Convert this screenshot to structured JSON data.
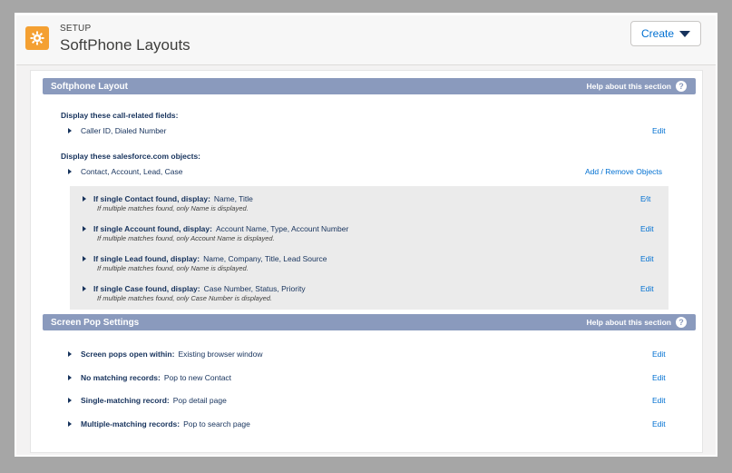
{
  "header": {
    "eyebrow": "SETUP",
    "title": "SoftPhone Layouts",
    "create_label": "Create"
  },
  "softphone": {
    "section_title": "Softphone Layout",
    "help_label": "Help about this section",
    "call_fields_heading": "Display these call-related fields:",
    "call_fields_value": "Caller ID, Dialed Number",
    "call_fields_edit": "Edit",
    "objects_heading": "Display these salesforce.com objects:",
    "objects_value": "Contact, Account, Lead, Case",
    "objects_action": "Add / Remove Objects",
    "items": [
      {
        "label": "If single Contact found, display:",
        "value": "Name, Title",
        "note": "If multiple matches found, only Name is displayed.",
        "edit": "E⁄it"
      },
      {
        "label": "If single Account found, display:",
        "value": "Account Name, Type, Account Number",
        "note": "If multiple matches found, only Account Name is displayed.",
        "edit": "Edit"
      },
      {
        "label": "If single Lead found, display:",
        "value": "Name, Company, Title, Lead Source",
        "note": "If multiple matches found, only Name is displayed.",
        "edit": "Edit"
      },
      {
        "label": "If single Case found, display:",
        "value": "Case Number, Status, Priority",
        "note": "If multiple matches found, only Case Number is displayed.",
        "edit": "Edit"
      }
    ]
  },
  "screen_pop": {
    "section_title": "Screen Pop Settings",
    "help_label": "Help about this section",
    "rows": [
      {
        "label": "Screen pops open within:",
        "value": "Existing browser window",
        "edit": "Edit"
      },
      {
        "label": "No matching records:",
        "value": "Pop to new Contact",
        "edit": "Edit"
      },
      {
        "label": "Single-matching record:",
        "value": "Pop detail page",
        "edit": "Edit"
      },
      {
        "label": "Multiple-matching records:",
        "value": "Pop to search page",
        "edit": "Edit"
      }
    ]
  },
  "colors": {
    "section_bar": "#8a9abd",
    "link": "#0070d2",
    "setup_icon": "#f4a032"
  },
  "icons": {
    "setup": "gear-icon",
    "help": "question-circle-icon",
    "create_menu": "caret-down-icon",
    "expand": "triangle-right-icon"
  }
}
